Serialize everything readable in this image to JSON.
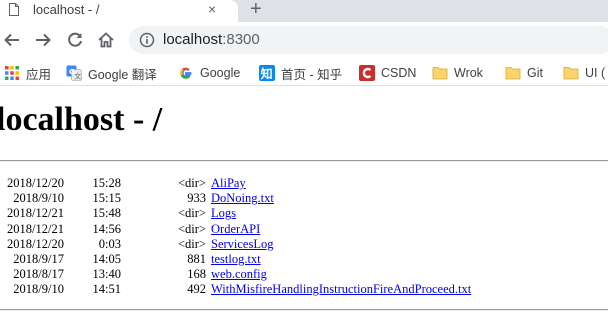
{
  "browser": {
    "tab": {
      "title": "localhost - /",
      "close_glyph": "×"
    },
    "new_tab_glyph": "+",
    "address": {
      "host": "localhost",
      "port": ":8300"
    },
    "bookmarks": [
      {
        "label": "应用",
        "icon": "apps-grid-icon"
      },
      {
        "label": "Google 翻译",
        "icon": "google-translate-icon"
      },
      {
        "label": "Google",
        "icon": "google-g-icon"
      },
      {
        "label": "首页 - 知乎",
        "icon": "zhihu-icon",
        "icon_text": "知"
      },
      {
        "label": "CSDN",
        "icon": "csdn-icon"
      },
      {
        "label": "Wrok",
        "icon": "folder-icon"
      },
      {
        "label": "Git",
        "icon": "folder-icon"
      },
      {
        "label": "UI (",
        "icon": "folder-icon"
      }
    ]
  },
  "page": {
    "heading": "localhost - /",
    "entries": [
      {
        "date": "2018/12/20",
        "time": "15:28",
        "size": "<dir>",
        "name": "AliPay"
      },
      {
        "date": "2018/9/10",
        "time": "15:15",
        "size": "933",
        "name": "DoNoing.txt"
      },
      {
        "date": "2018/12/21",
        "time": "15:48",
        "size": "<dir>",
        "name": "Logs"
      },
      {
        "date": "2018/12/21",
        "time": "14:56",
        "size": "<dir>",
        "name": "OrderAPI"
      },
      {
        "date": "2018/12/20",
        "time": "0:03",
        "size": "<dir>",
        "name": "ServicesLog"
      },
      {
        "date": "2018/9/17",
        "time": "14:05",
        "size": "881",
        "name": "testlog.txt"
      },
      {
        "date": "2018/8/17",
        "time": "13:40",
        "size": "168",
        "name": "web.config"
      },
      {
        "date": "2018/9/10",
        "time": "14:51",
        "size": "492",
        "name": "WithMisfireHandlingInstructionFireAndProceed.txt"
      }
    ]
  },
  "colors": {
    "link": "#0000ee",
    "tabstrip": "#dee1e6",
    "omnibox": "#f1f3f4",
    "folder": "#f9d46c",
    "csdn": "#c9302c",
    "zhihu": "#0f88eb"
  }
}
